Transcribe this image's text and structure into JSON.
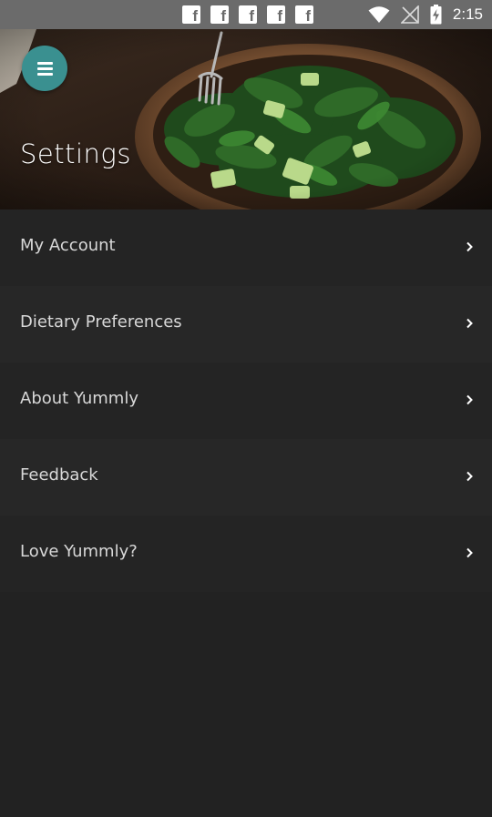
{
  "status_bar": {
    "time": "2:15",
    "notification_icons": [
      "facebook-icon",
      "facebook-icon",
      "facebook-icon",
      "facebook-icon",
      "facebook-icon"
    ],
    "system_icons": [
      "wifi-icon",
      "no-signal-icon",
      "battery-charging-icon"
    ]
  },
  "header": {
    "title": "Settings",
    "menu_icon": "hamburger-menu-icon",
    "background_image": "salad-bowl-photo",
    "fab_color": "#3a9090"
  },
  "settings": {
    "items": [
      {
        "label": "My Account",
        "icon": "chevron-right-icon"
      },
      {
        "label": "Dietary Preferences",
        "icon": "chevron-right-icon"
      },
      {
        "label": "About Yummly",
        "icon": "chevron-right-icon"
      },
      {
        "label": "Feedback",
        "icon": "chevron-right-icon"
      },
      {
        "label": "Love Yummly?",
        "icon": "chevron-right-icon"
      }
    ]
  },
  "colors": {
    "background": "#222222",
    "row_alt": "#272727",
    "text": "#d8d8d8",
    "status_bar": "#6b6b6b"
  }
}
